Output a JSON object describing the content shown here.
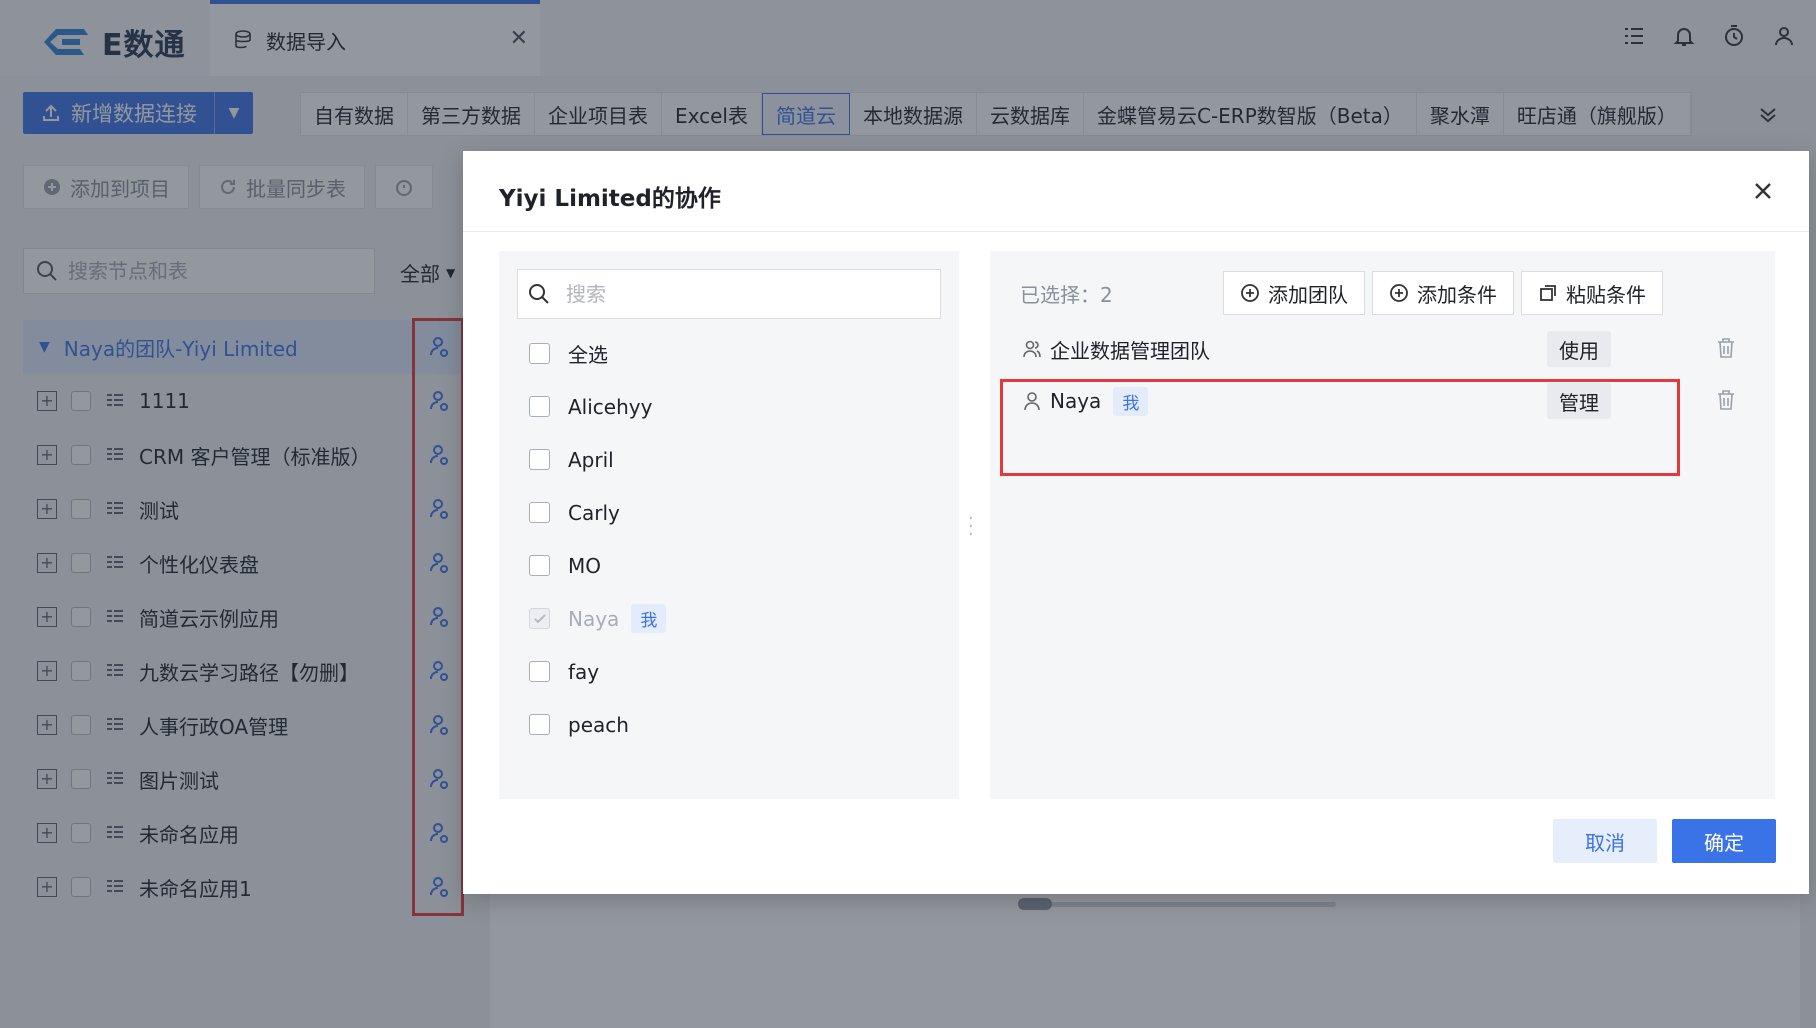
{
  "app": {
    "logo_text": "E数通"
  },
  "top_tab": {
    "label": "数据导入"
  },
  "toolbar": {
    "new_connection": "新增数据连接",
    "add_to_project": "添加到项目",
    "batch_sync": "批量同步表"
  },
  "source_tabs": [
    "自有数据",
    "第三方数据",
    "企业项目表",
    "Excel表",
    "简道云",
    "本地数据源",
    "云数据库",
    "金蝶管易云C-ERP数智版（Beta）",
    "聚水潭",
    "旺店通（旗舰版）"
  ],
  "active_source_tab": "简道云",
  "left_panel": {
    "search_placeholder": "搜索节点和表",
    "filter": "全部",
    "root": "Naya的团队-Yiyi Limited",
    "items": [
      "1111",
      "CRM 客户管理（标准版）",
      "测试",
      "个性化仪表盘",
      "简道云示例应用",
      "九数云学习路径【勿删】",
      "人事行政OA管理",
      "图片测试",
      "未命名应用",
      "未命名应用1"
    ]
  },
  "modal": {
    "title": "Yiyi Limited的协作",
    "search_placeholder": "搜索",
    "select_all": "全选",
    "members": [
      {
        "name": "Alicehyy",
        "checked": false,
        "disabled": false,
        "me": false
      },
      {
        "name": "April",
        "checked": false,
        "disabled": false,
        "me": false
      },
      {
        "name": "Carly",
        "checked": false,
        "disabled": false,
        "me": false
      },
      {
        "name": "MO",
        "checked": false,
        "disabled": false,
        "me": false
      },
      {
        "name": "Naya",
        "checked": true,
        "disabled": true,
        "me": true
      },
      {
        "name": "fay",
        "checked": false,
        "disabled": false,
        "me": false
      },
      {
        "name": "peach",
        "checked": false,
        "disabled": false,
        "me": false
      }
    ],
    "me_tag": "我",
    "selected_label": "已选择：2",
    "add_team": "添加团队",
    "add_condition": "添加条件",
    "paste_condition": "粘贴条件",
    "selected": [
      {
        "name": "企业数据管理团队",
        "type": "team",
        "permission": "使用"
      },
      {
        "name": "Naya",
        "type": "user",
        "permission": "管理",
        "me": true
      }
    ],
    "cancel": "取消",
    "confirm": "确定"
  },
  "colors": {
    "accent": "#3a72e8",
    "highlight": "#e5383b"
  }
}
